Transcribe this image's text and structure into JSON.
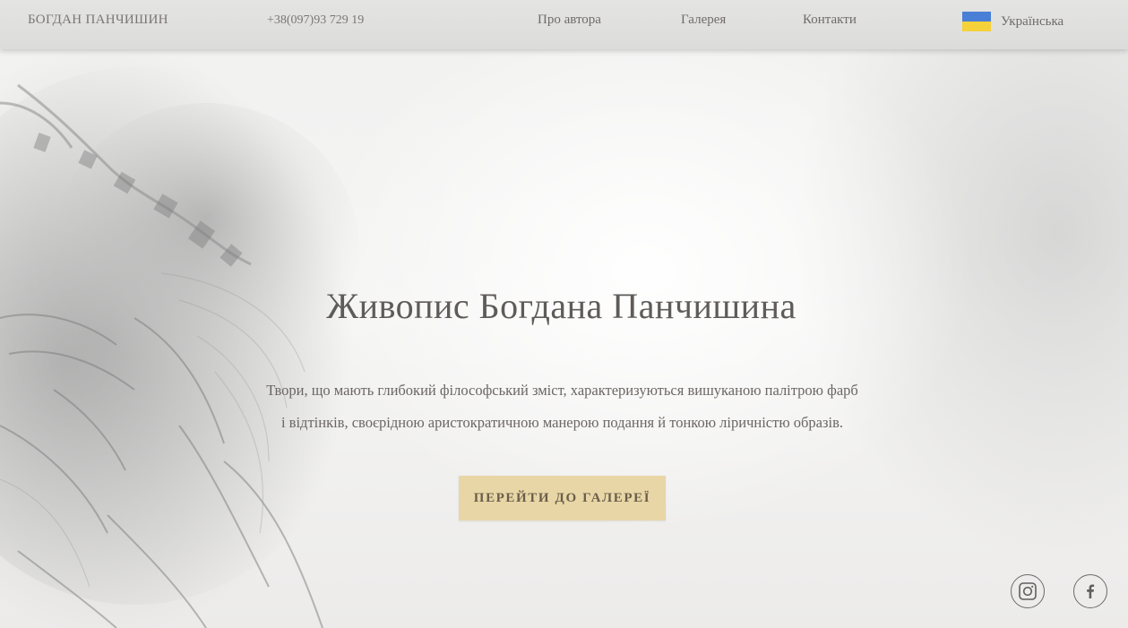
{
  "header": {
    "brand": "БОГДАН ПАНЧИШИН",
    "phone": "+38(097)93 729 19",
    "nav": {
      "about": "Про автора",
      "gallery": "Галерея",
      "contacts": "Контакти"
    },
    "language": {
      "label": "Українська",
      "flag_colors": [
        "#4a7fd6",
        "#f5d13a"
      ]
    }
  },
  "hero": {
    "title": "Живопис Богдана Панчишина",
    "description_line1": "Твори, що мають глибокий філософський зміст, характеризуються вишуканою палітрою фарб",
    "description_line2": "і відтінків, своєрідною аристократичною манерою подання й тонкою ліричністю образів.",
    "cta_label": "ПЕРЕЙТИ ДО ГАЛЕРЕЇ",
    "cta_color": "#e8d6a6"
  },
  "social": {
    "instagram_icon": "instagram-icon",
    "facebook_icon": "facebook-icon"
  }
}
